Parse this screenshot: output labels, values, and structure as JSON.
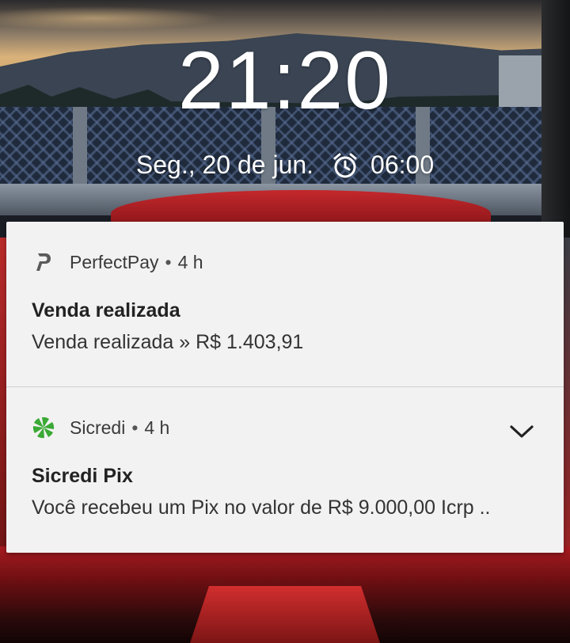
{
  "lockscreen": {
    "time": "21:20",
    "date": "Seg., 20 de jun.",
    "alarm_icon": "alarm-clock-icon",
    "alarm_time": "06:00"
  },
  "notifications": [
    {
      "app_icon": "perfectpay-logo-icon",
      "app_name": "PerfectPay",
      "separator": "•",
      "age": "4 h",
      "title": "Venda realizada",
      "text": "Venda realizada » R$ 1.403,91"
    },
    {
      "app_icon": "sicredi-logo-icon",
      "app_name": "Sicredi",
      "separator": "•",
      "age": "4 h",
      "title": "Sicredi Pix",
      "text": "Você recebeu um Pix no valor de R$ 9.000,00 Icrp ..",
      "expand_icon": "chevron-down-icon"
    }
  ],
  "colors": {
    "panel_background": "#f2f2f2",
    "sicredi_green": "#3aa935",
    "text_primary": "#222222"
  }
}
